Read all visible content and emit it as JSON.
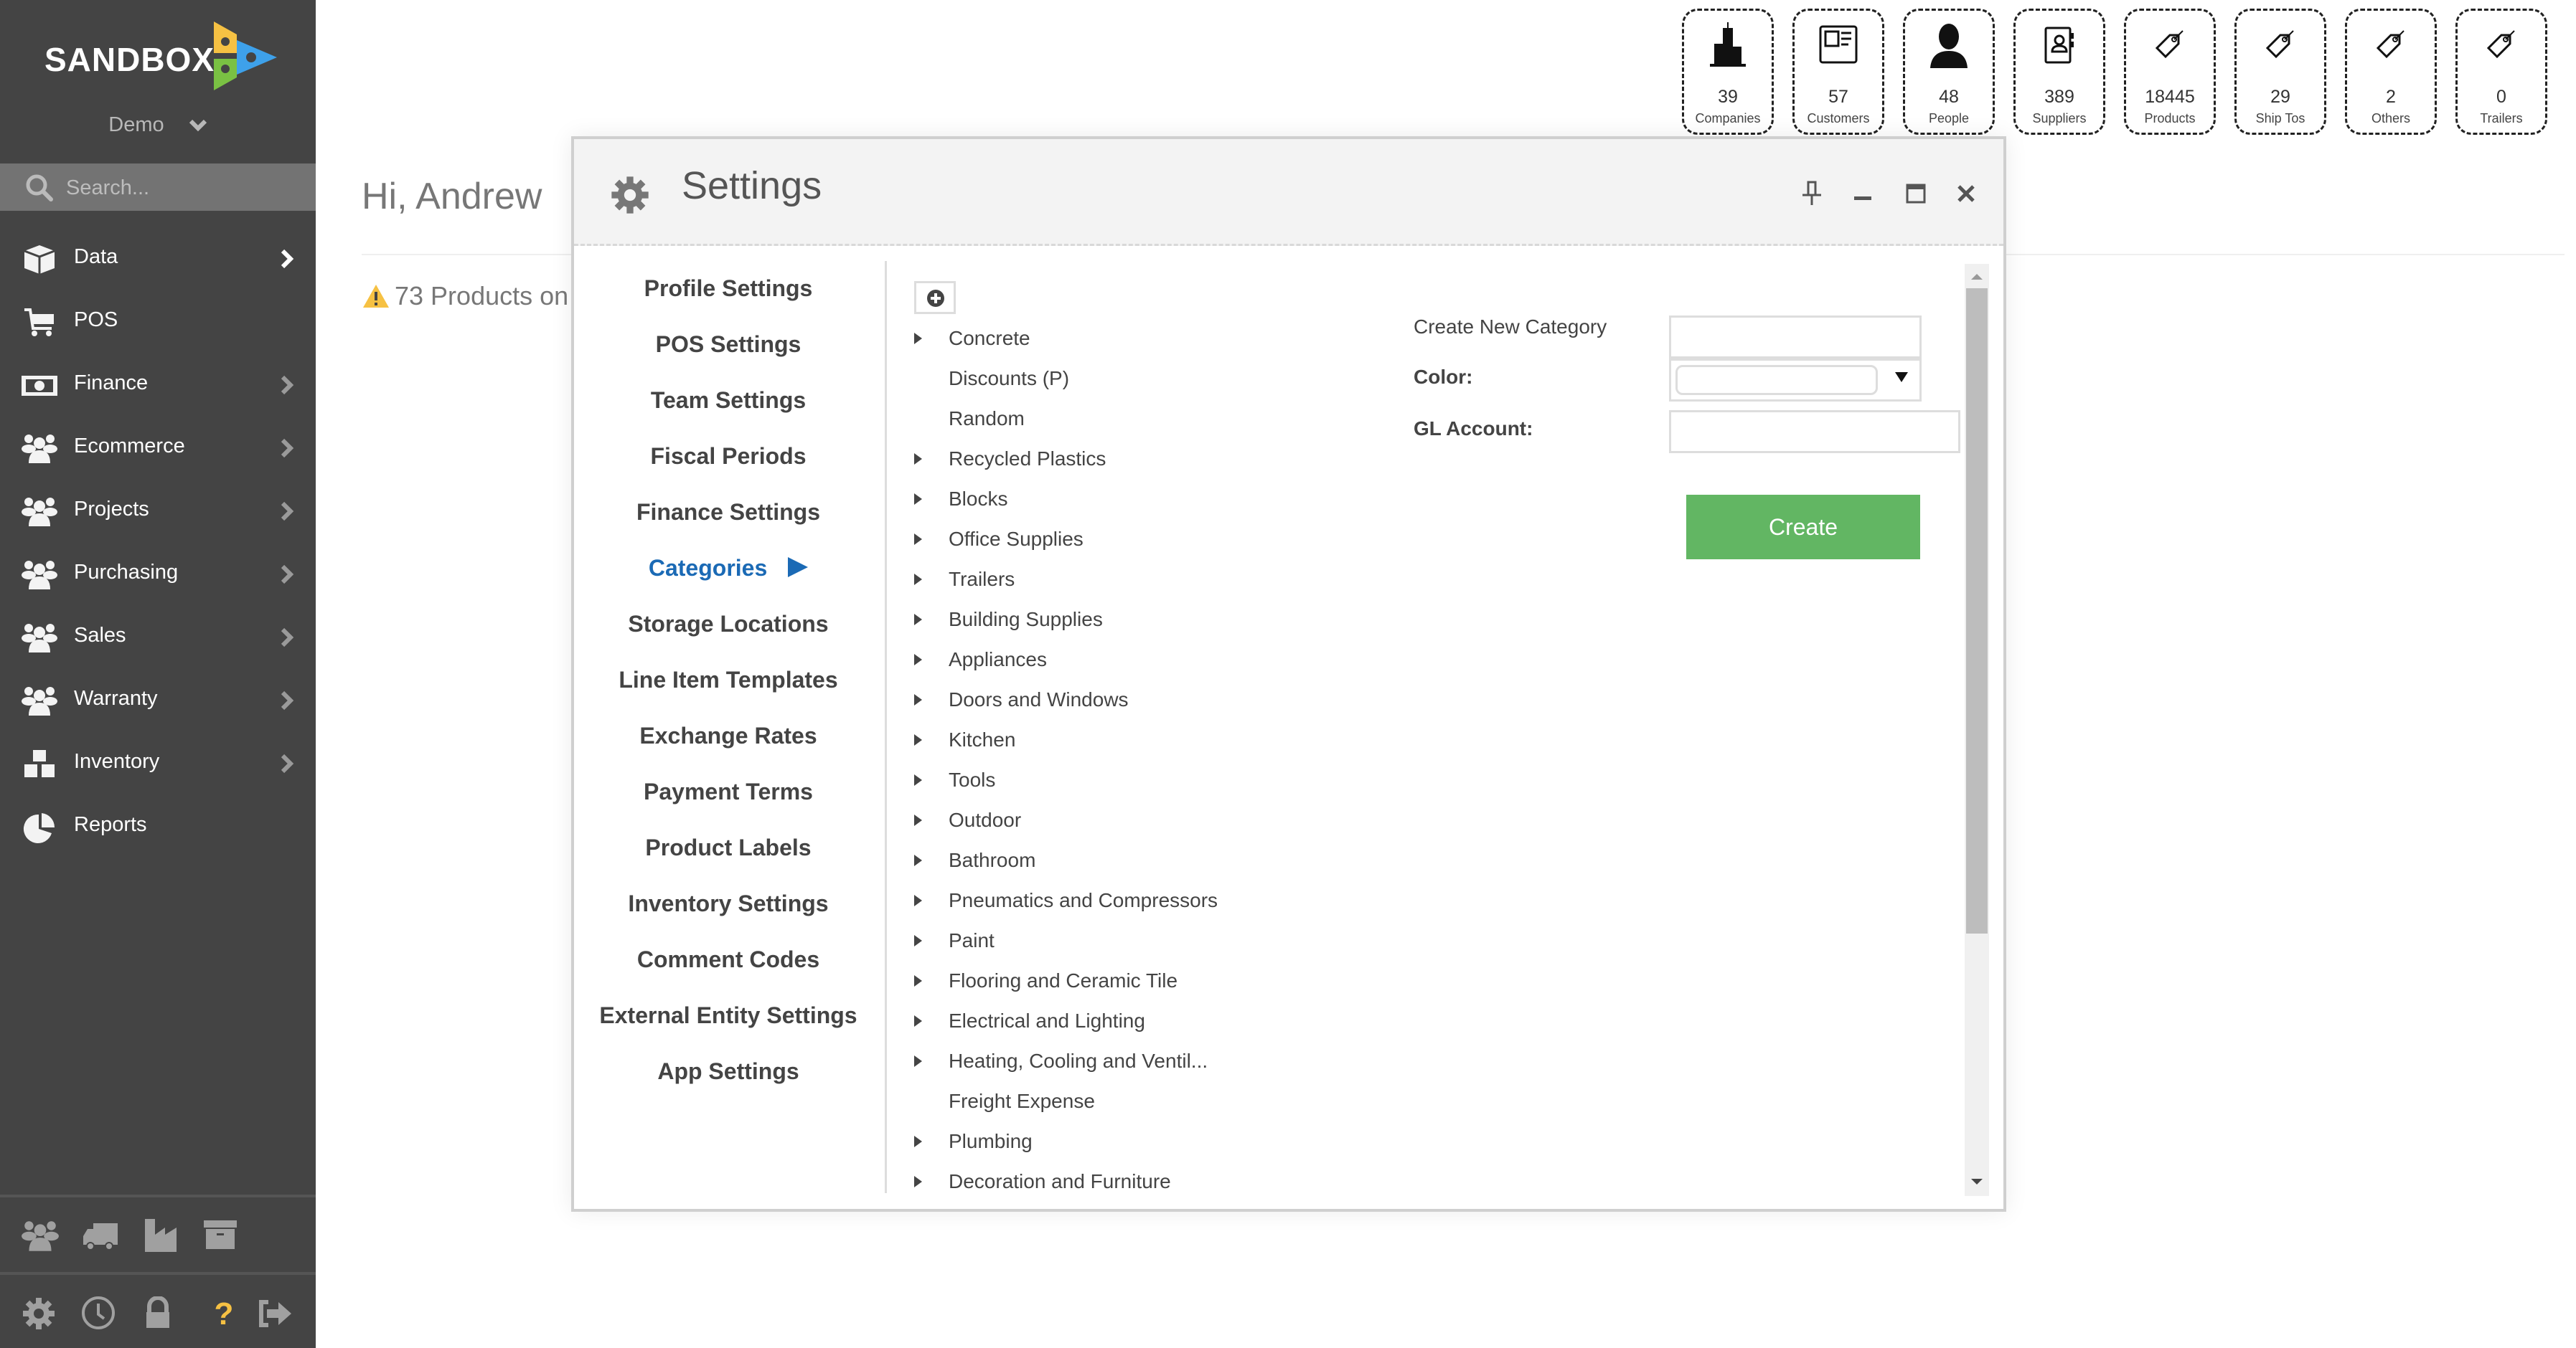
{
  "brand": {
    "name": "SANDBOX",
    "logo_colors": [
      "#f6c143",
      "#3ea1ea",
      "#7ac143"
    ]
  },
  "sidebar": {
    "workspace": "Demo",
    "search_placeholder": "Search...",
    "items": [
      {
        "label": "Data",
        "icon": "cube-icon",
        "has_submenu": true
      },
      {
        "label": "POS",
        "icon": "cart-icon",
        "has_submenu": false
      },
      {
        "label": "Finance",
        "icon": "money-icon",
        "has_submenu": true
      },
      {
        "label": "Ecommerce",
        "icon": "users-icon",
        "has_submenu": true
      },
      {
        "label": "Projects",
        "icon": "users-icon",
        "has_submenu": true
      },
      {
        "label": "Purchasing",
        "icon": "users-icon",
        "has_submenu": true
      },
      {
        "label": "Sales",
        "icon": "users-icon",
        "has_submenu": true
      },
      {
        "label": "Warranty",
        "icon": "users-icon",
        "has_submenu": true
      },
      {
        "label": "Inventory",
        "icon": "cubes-icon",
        "has_submenu": true
      },
      {
        "label": "Reports",
        "icon": "pie-chart-icon",
        "has_submenu": false
      }
    ],
    "quick_icons": [
      "users-icon",
      "truck-icon",
      "factory-icon",
      "archive-icon"
    ],
    "footer_icons": [
      "gear-icon",
      "clock-icon",
      "lock-icon",
      "help-icon",
      "logout-icon"
    ],
    "help_color": "#f6c143"
  },
  "main": {
    "greeting": "Hi, Andrew",
    "alert": "73 Products on"
  },
  "stats": [
    {
      "value": "39",
      "label": "Companies",
      "icon": "buildings-icon"
    },
    {
      "value": "57",
      "label": "Customers",
      "icon": "id-card-icon"
    },
    {
      "value": "48",
      "label": "People",
      "icon": "person-icon"
    },
    {
      "value": "389",
      "label": "Suppliers",
      "icon": "address-book-icon"
    },
    {
      "value": "18445",
      "label": "Products",
      "icon": "tag-icon"
    },
    {
      "value": "29",
      "label": "Ship Tos",
      "icon": "tag-icon"
    },
    {
      "value": "2",
      "label": "Others",
      "icon": "tag-icon"
    },
    {
      "value": "0",
      "label": "Trailers",
      "icon": "tag-icon"
    }
  ],
  "dialog": {
    "title": "Settings",
    "menu": [
      {
        "label": "Profile Settings",
        "active": false
      },
      {
        "label": "POS Settings",
        "active": false
      },
      {
        "label": "Team Settings",
        "active": false
      },
      {
        "label": "Fiscal Periods",
        "active": false
      },
      {
        "label": "Finance Settings",
        "active": false
      },
      {
        "label": "Categories",
        "active": true
      },
      {
        "label": "Storage Locations",
        "active": false
      },
      {
        "label": "Line Item Templates",
        "active": false
      },
      {
        "label": "Exchange Rates",
        "active": false
      },
      {
        "label": "Payment Terms",
        "active": false
      },
      {
        "label": "Product Labels",
        "active": false
      },
      {
        "label": "Inventory Settings",
        "active": false
      },
      {
        "label": "Comment Codes",
        "active": false
      },
      {
        "label": "External Entity Settings",
        "active": false
      },
      {
        "label": "App Settings",
        "active": false
      }
    ],
    "active_color": "#1b6ab5",
    "categories": [
      {
        "label": "Concrete",
        "expandable": true
      },
      {
        "label": "Discounts (P)",
        "expandable": false
      },
      {
        "label": "Random",
        "expandable": false
      },
      {
        "label": "Recycled Plastics",
        "expandable": true
      },
      {
        "label": "Blocks",
        "expandable": true
      },
      {
        "label": "Office Supplies",
        "expandable": true
      },
      {
        "label": "Trailers",
        "expandable": true
      },
      {
        "label": "Building Supplies",
        "expandable": true
      },
      {
        "label": "Appliances",
        "expandable": true
      },
      {
        "label": "Doors and Windows",
        "expandable": true
      },
      {
        "label": "Kitchen",
        "expandable": true
      },
      {
        "label": "Tools",
        "expandable": true
      },
      {
        "label": "Outdoor",
        "expandable": true
      },
      {
        "label": "Bathroom",
        "expandable": true
      },
      {
        "label": "Pneumatics and Compressors",
        "expandable": true
      },
      {
        "label": "Paint",
        "expandable": true
      },
      {
        "label": "Flooring and Ceramic Tile",
        "expandable": true
      },
      {
        "label": "Electrical and Lighting",
        "expandable": true
      },
      {
        "label": "Heating, Cooling and Ventil...",
        "expandable": true
      },
      {
        "label": "Freight Expense",
        "expandable": false
      },
      {
        "label": "Plumbing",
        "expandable": true
      },
      {
        "label": "Decoration and Furniture",
        "expandable": true
      }
    ],
    "form": {
      "create_label": "Create New Category",
      "create_value": "",
      "color_label": "Color:",
      "color_value": "",
      "gl_label": "GL Account:",
      "gl_value": "",
      "create_button": "Create",
      "button_color": "#62b663"
    }
  }
}
